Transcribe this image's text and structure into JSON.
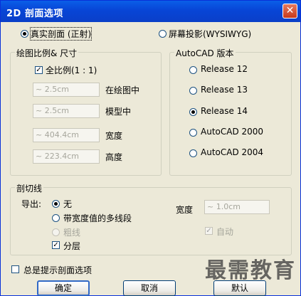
{
  "window": {
    "title": "2D 剖面选项",
    "close_glyph": "✕"
  },
  "mode": {
    "real_section": "真实剖面 (正射)",
    "screen_projection": "屏幕投影(WYSIWYG)",
    "selected": "real_section"
  },
  "scale_size": {
    "group_title": "绘图比例& 尺寸",
    "full_scale_label": "全比例(1 : 1)",
    "full_scale_checked": true,
    "rows": [
      {
        "value": "~ 2.5cm",
        "label": "在绘图中"
      },
      {
        "value": "~ 2.5cm",
        "label": "模型中"
      },
      {
        "value": "~ 404.4cm",
        "label": "宽度"
      },
      {
        "value": "~ 223.4cm",
        "label": "高度"
      }
    ]
  },
  "autocad_version": {
    "group_title": "AutoCAD 版本",
    "options": [
      "Release 12",
      "Release 13",
      "Release 14",
      "AutoCAD 2000",
      "AutoCAD 2004"
    ],
    "selected": "Release 14"
  },
  "section_line": {
    "group_title": "剖切线",
    "export_label": "导出:",
    "options": [
      "无",
      "带宽度值的多线段",
      "粗线"
    ],
    "selected": "无",
    "layer_label": "分层",
    "layer_checked": true,
    "width_label": "宽度",
    "width_value": "~ 1.0cm",
    "auto_label": "自动",
    "auto_checked": true
  },
  "always_prompt_label": "总是提示剖面选项",
  "always_prompt_checked": false,
  "buttons": {
    "ok": "确定",
    "cancel": "取消",
    "default": "默认"
  },
  "watermark": "最需教育"
}
